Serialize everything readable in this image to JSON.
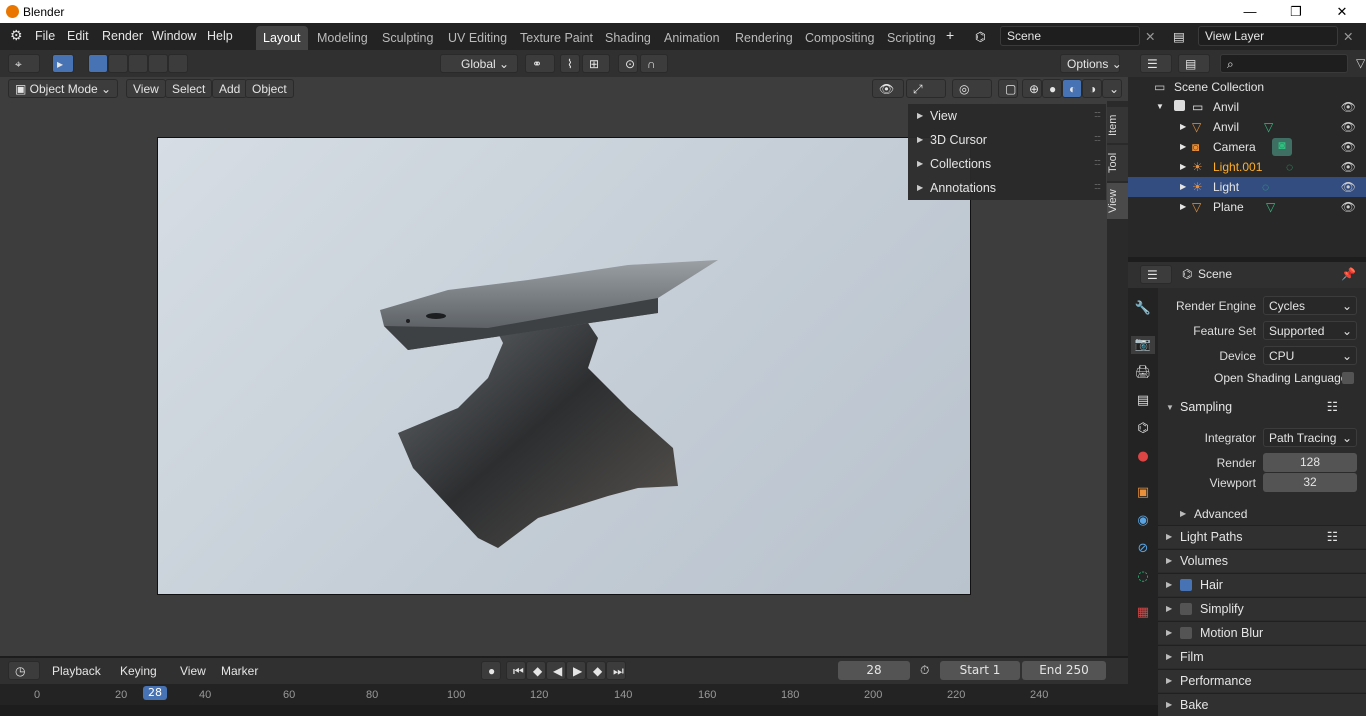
{
  "window": {
    "title": "Blender"
  },
  "menu": [
    "File",
    "Edit",
    "Render",
    "Window",
    "Help"
  ],
  "workspaces": [
    "Layout",
    "Modeling",
    "Sculpting",
    "UV Editing",
    "Texture Paint",
    "Shading",
    "Animation",
    "Rendering",
    "Compositing",
    "Scripting"
  ],
  "active_workspace": "Layout",
  "scene_field": "Scene",
  "view_layer_field": "View Layer",
  "viewport_header": {
    "orientation": "Global",
    "options": "Options"
  },
  "viewport_header2": {
    "mode": "Object Mode",
    "view": "View",
    "select": "Select",
    "add": "Add",
    "object": "Object"
  },
  "npanel": {
    "items": [
      "View",
      "3D Cursor",
      "Collections",
      "Annotations"
    ],
    "tabs": [
      "Item",
      "Tool",
      "View"
    ]
  },
  "timeline": {
    "playback": "Playback",
    "keying": "Keying",
    "view": "View",
    "marker": "Marker",
    "current_frame": "28",
    "start_label": "Start",
    "start": "1",
    "end_label": "End",
    "end": "250",
    "ticks": [
      "0",
      "20",
      "40",
      "60",
      "80",
      "100",
      "120",
      "140",
      "160",
      "180",
      "200",
      "220",
      "240"
    ],
    "cursor": "28"
  },
  "outliner": {
    "root": "Scene Collection",
    "items": [
      {
        "name": "Anvil",
        "type": "collection"
      },
      {
        "name": "Anvil",
        "type": "mesh"
      },
      {
        "name": "Camera",
        "type": "camera"
      },
      {
        "name": "Light.001",
        "type": "light",
        "highlight": true
      },
      {
        "name": "Light",
        "type": "light",
        "selected": true
      },
      {
        "name": "Plane",
        "type": "mesh"
      }
    ]
  },
  "properties": {
    "context": "Scene",
    "render_engine_label": "Render Engine",
    "render_engine": "Cycles",
    "feature_set_label": "Feature Set",
    "feature_set": "Supported",
    "device_label": "Device",
    "device": "CPU",
    "osl_label": "Open Shading Language",
    "sampling": "Sampling",
    "integrator_label": "Integrator",
    "integrator": "Path Tracing",
    "render_label": "Render",
    "render": "128",
    "viewport_label": "Viewport",
    "viewport": "32",
    "advanced": "Advanced",
    "sections": [
      "Light Paths",
      "Volumes",
      "Hair",
      "Simplify",
      "Motion Blur",
      "Film",
      "Performance",
      "Bake"
    ]
  },
  "colors": {
    "accent": "#4772b3",
    "selected_row": "#334d80",
    "highlight_text": "#ffaf29"
  }
}
